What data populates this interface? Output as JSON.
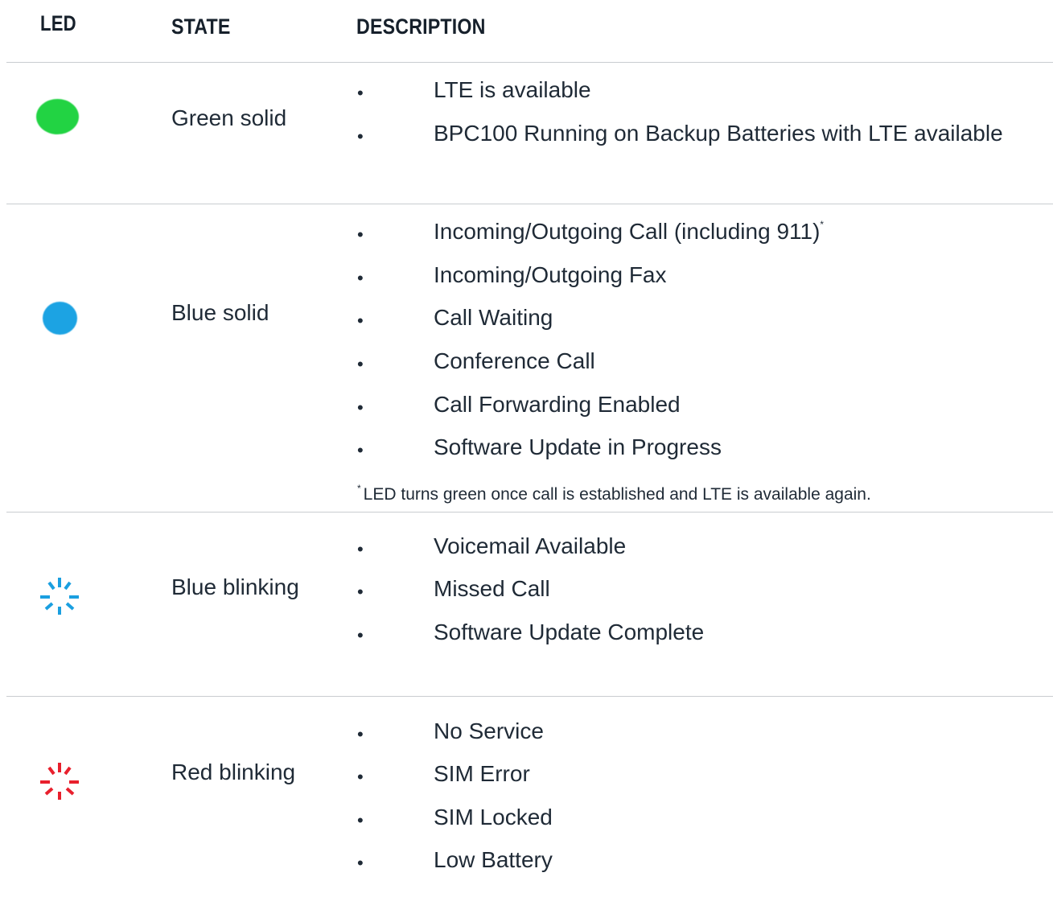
{
  "headers": {
    "led": "LED",
    "state": "STATE",
    "description": "DESCRIPTION"
  },
  "colors": {
    "green": "#22d343",
    "blue": "#1ca3e3",
    "blue_blink": "#1a9fe0",
    "red_blink": "#e8202d"
  },
  "rows": [
    {
      "led_icon": "led-green-solid-icon",
      "state": "Green solid",
      "items": [
        "LTE is available",
        "BPC100 Running on Backup Batteries with LTE available"
      ]
    },
    {
      "led_icon": "led-blue-solid-icon",
      "state": "Blue solid",
      "items": [
        "Incoming/Outgoing Call (including 911)",
        "Incoming/Outgoing Fax",
        "Call Waiting",
        "Conference Call",
        "Call Forwarding Enabled",
        "Software Update in Progress"
      ],
      "item_superscript": "*",
      "note_marker": "*",
      "note": "LED turns green once call is established and LTE is available again."
    },
    {
      "led_icon": "led-blue-blinking-icon",
      "state": "Blue blinking",
      "items": [
        "Voicemail Available",
        "Missed Call",
        "Software Update Complete"
      ]
    },
    {
      "led_icon": "led-red-blinking-icon",
      "state": "Red blinking",
      "items": [
        "No Service",
        "SIM Error",
        "SIM Locked",
        "Low Battery"
      ]
    }
  ],
  "bullet_glyph": "•"
}
